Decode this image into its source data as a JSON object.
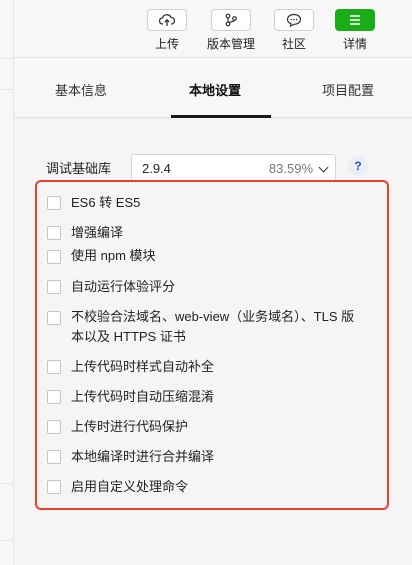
{
  "toolbar": {
    "buttons": [
      {
        "label": "上传",
        "icon": "upload-cloud-icon"
      },
      {
        "label": "版本管理",
        "icon": "version-branch-icon"
      },
      {
        "label": "社区",
        "icon": "chat-bubble-icon"
      },
      {
        "label": "详情",
        "icon": "menu-list-icon"
      }
    ]
  },
  "tabs": [
    {
      "label": "基本信息",
      "active": false
    },
    {
      "label": "本地设置",
      "active": true
    },
    {
      "label": "项目配置",
      "active": false
    }
  ],
  "base_lib": {
    "label": "调试基础库",
    "version": "2.9.4",
    "percent": "83.59%",
    "help": "?"
  },
  "options": [
    {
      "label": "ES6 转 ES5",
      "checked": false
    },
    {
      "label": "增强编译",
      "checked": false
    },
    {
      "label": "使用 npm 模块",
      "checked": false
    },
    {
      "label": "自动运行体验评分",
      "checked": false
    },
    {
      "label_line1": "不校验合法域名、web-view（业务域名）、TLS 版",
      "label_line2": "本以及 HTTPS 证书",
      "checked": false
    },
    {
      "label": "上传代码时样式自动补全",
      "checked": false
    },
    {
      "label": "上传代码时自动压缩混淆",
      "checked": false
    },
    {
      "label": "上传时进行代码保护",
      "checked": false
    },
    {
      "label": "本地编译时进行合并编译",
      "checked": false
    },
    {
      "label": "启用自定义处理命令",
      "checked": false
    }
  ],
  "colors": {
    "highlight_border": "#e8412c",
    "details_green": "#1aad19"
  }
}
